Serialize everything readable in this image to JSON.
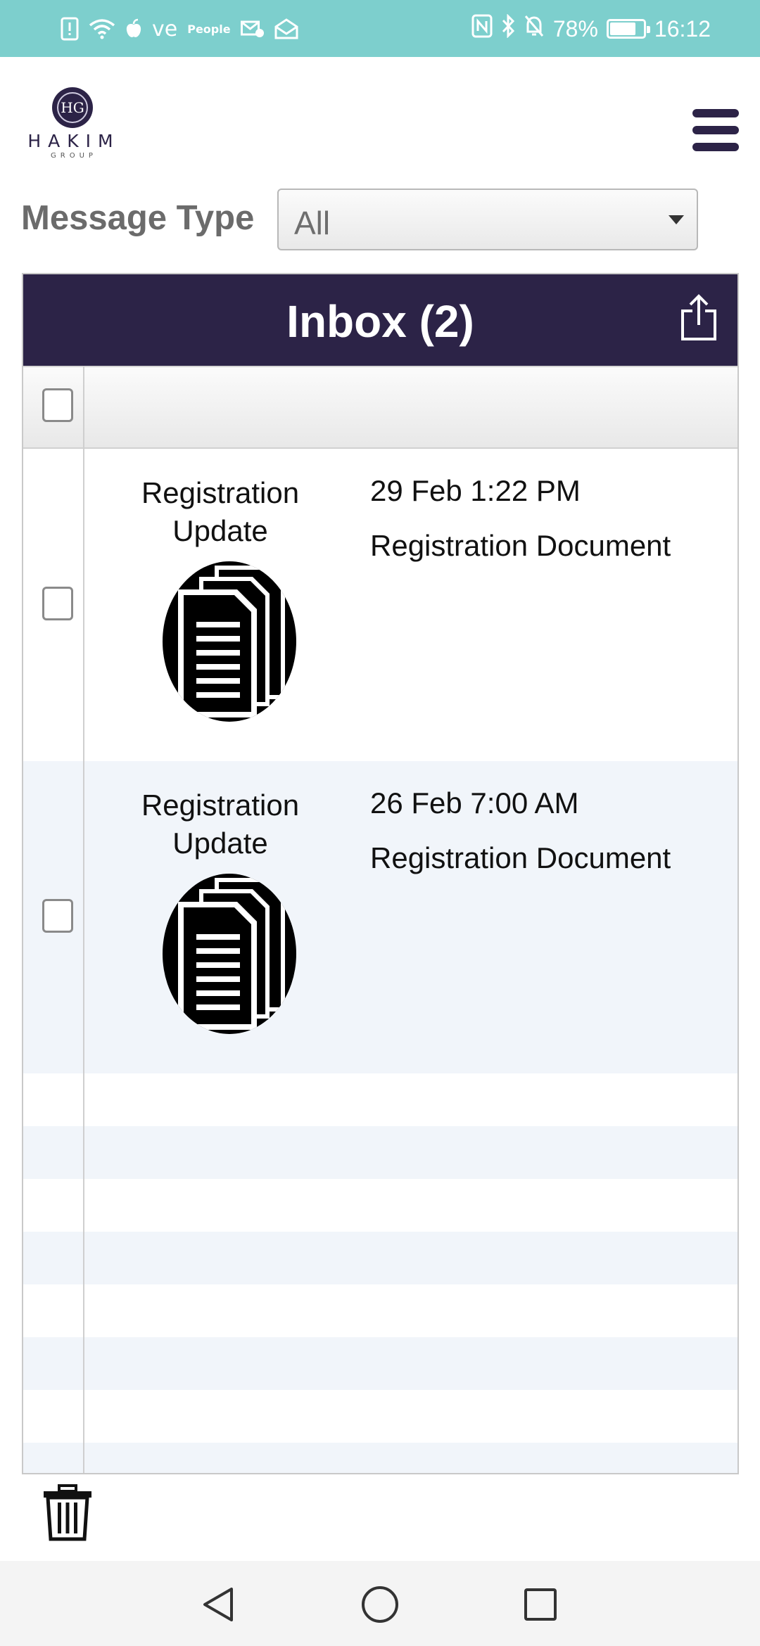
{
  "status_bar": {
    "carrier_text": "ve",
    "app_text": "People",
    "battery": "78%",
    "battery_level": 0.78,
    "time": "16:12"
  },
  "brand": {
    "monogram": "HG",
    "name": "HAKIM",
    "sub": "GROUP"
  },
  "filter": {
    "label": "Message Type",
    "selected": "All"
  },
  "inbox": {
    "title": "Inbox (2)",
    "messages": [
      {
        "type": "Registration Update",
        "date": "29 Feb 1:22 PM",
        "subject": "Registration Document"
      },
      {
        "type": "Registration Update",
        "date": "26 Feb 7:00 AM",
        "subject": "Registration Document"
      }
    ]
  },
  "colors": {
    "status_bar": "#7dcfcd",
    "brand_dark": "#2c2347",
    "row_alt": "#f1f5fa"
  }
}
